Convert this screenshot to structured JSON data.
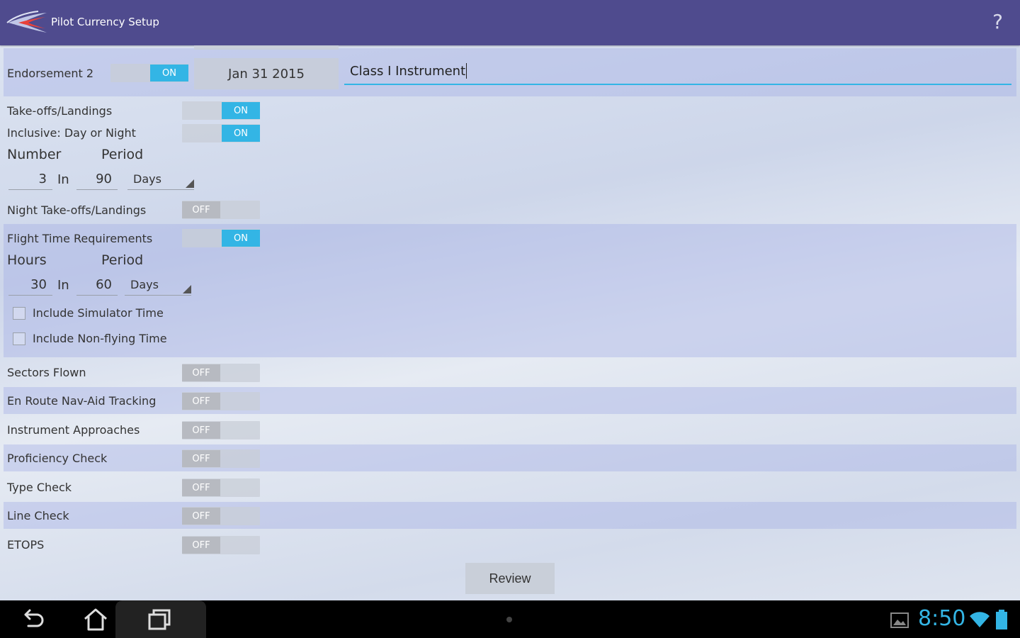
{
  "app": {
    "title": "Pilot Currency Setup",
    "help": "?"
  },
  "endorsement": {
    "label": "Endorsement 2",
    "toggle": "ON",
    "date": "Jan 31 2015",
    "name_value": "Class I Instrument"
  },
  "takeoffs": {
    "label": "Take-offs/Landings",
    "toggle": "ON",
    "inclusive_label": "Inclusive: Day or Night",
    "inclusive_toggle": "ON",
    "number_header": "Number",
    "period_header": "Period",
    "number": "3",
    "in_label": "In",
    "period": "90",
    "unit": "Days"
  },
  "night": {
    "label": "Night Take-offs/Landings",
    "toggle": "OFF"
  },
  "flight_time": {
    "label": "Flight Time Requirements",
    "toggle": "ON",
    "hours_header": "Hours",
    "period_header": "Period",
    "hours": "30",
    "in_label": "In",
    "period": "60",
    "unit": "Days",
    "include_sim": "Include Simulator Time",
    "include_nonflying": "Include Non-flying Time"
  },
  "items": [
    {
      "label": "Sectors Flown",
      "toggle": "OFF"
    },
    {
      "label": "En Route Nav-Aid Tracking",
      "toggle": "OFF"
    },
    {
      "label": "Instrument Approaches",
      "toggle": "OFF"
    },
    {
      "label": "Proficiency Check",
      "toggle": "OFF"
    },
    {
      "label": "Type Check",
      "toggle": "OFF"
    },
    {
      "label": "Line Check",
      "toggle": "OFF"
    },
    {
      "label": "ETOPS",
      "toggle": "OFF"
    }
  ],
  "review_label": "Review",
  "status": {
    "time": "8:50"
  },
  "colors": {
    "actionbar": "#4f4b8e",
    "accent": "#33b5e5"
  }
}
